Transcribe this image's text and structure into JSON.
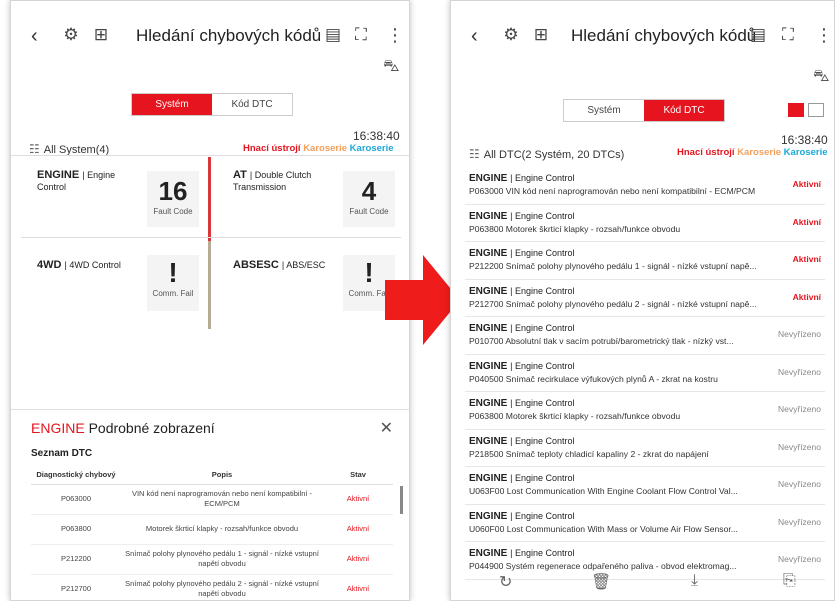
{
  "left": {
    "title": "Hledání chybových kódů",
    "tabs": [
      "Systém",
      "Kód DTC"
    ],
    "active_tab": 0,
    "time": "16:38:40",
    "summary": "All System(4)",
    "categories": [
      "Hnací ústrojí",
      "Karoserie",
      "Karoserie"
    ],
    "cards": [
      {
        "name": "ENGINE",
        "sub": "Engine Control",
        "value": "16",
        "label": "Fault Code",
        "bar_color": "#d9383a"
      },
      {
        "name": "AT",
        "sub": "Double Clutch Transmission",
        "value": "4",
        "label": "Fault Code",
        "bar_color": ""
      },
      {
        "name": "4WD",
        "sub": "4WD Control",
        "value": "!",
        "label": "Comm. Fail",
        "bar_color": "#b8ab95"
      },
      {
        "name": "ABSESC",
        "sub": "ABS/ESC",
        "value": "!",
        "label": "Comm. Fail",
        "bar_color": ""
      }
    ],
    "detail": {
      "system": "ENGINE",
      "title": "Podrobné zobrazení",
      "list_title": "Seznam DTC",
      "columns": [
        "Diagnostický chybový",
        "Popis",
        "Stav"
      ],
      "rows": [
        {
          "code": "P063000",
          "desc": "VIN kód není naprogramován nebo není kompatibilní - ECM/PCM",
          "status": "Aktivní"
        },
        {
          "code": "P063800",
          "desc": "Motorek škrticí klapky - rozsah/funkce obvodu",
          "status": "Aktivní"
        },
        {
          "code": "P212200",
          "desc": "Snímač polohy plynového pedálu 1 - signál - nízké vstupní napětí obvodu",
          "status": "Aktivní"
        },
        {
          "code": "P212700",
          "desc": "Snímač polohy plynového pedálu 2 - signál - nízké vstupní napětí obvodu",
          "status": "Aktivní"
        }
      ]
    }
  },
  "right": {
    "title": "Hledání chybových kódů",
    "tabs": [
      "Systém",
      "Kód DTC"
    ],
    "active_tab": 1,
    "time": "16:38:40",
    "summary": "All DTC(2 Systém, 20 DTCs)",
    "categories": [
      "Hnací ústrojí",
      "Karoserie",
      "Karoserie"
    ],
    "dtcs": [
      {
        "sys": "ENGINE",
        "sub": "Engine Control",
        "desc": "P063000 VIN kód není naprogramován nebo není kompatibilní - ECM/PCM",
        "status": "Aktivní"
      },
      {
        "sys": "ENGINE",
        "sub": "Engine Control",
        "desc": "P063800 Motorek škrticí klapky - rozsah/funkce obvodu",
        "status": "Aktivní"
      },
      {
        "sys": "ENGINE",
        "sub": "Engine Control",
        "desc": "P212200 Snímač polohy plynového pedálu 1 - signál - nízké vstupní napě...",
        "status": "Aktivní"
      },
      {
        "sys": "ENGINE",
        "sub": "Engine Control",
        "desc": "P212700 Snímač polohy plynového pedálu 2 - signál - nízké vstupní napě...",
        "status": "Aktivní"
      },
      {
        "sys": "ENGINE",
        "sub": "Engine Control",
        "desc": "P010700 Absolutní tlak v sacím potrubí/barometrický tlak - nízký vst...",
        "status": "Nevyřízeno"
      },
      {
        "sys": "ENGINE",
        "sub": "Engine Control",
        "desc": "P040500 Snímač recirkulace výfukových plynů A - zkrat na kostru",
        "status": "Nevyřízeno"
      },
      {
        "sys": "ENGINE",
        "sub": "Engine Control",
        "desc": "P063800 Motorek škrticí klapky - rozsah/funkce obvodu",
        "status": "Nevyřízeno"
      },
      {
        "sys": "ENGINE",
        "sub": "Engine Control",
        "desc": "P218500 Snímač teploty chladicí kapaliny 2 - zkrat do napájení",
        "status": "Nevyřízeno"
      },
      {
        "sys": "ENGINE",
        "sub": "Engine Control",
        "desc": "U063F00 Lost Communication With Engine Coolant Flow Control Val...",
        "status": "Nevyřízeno"
      },
      {
        "sys": "ENGINE",
        "sub": "Engine Control",
        "desc": "U060F00 Lost Communication With Mass or Volume Air Flow Sensor...",
        "status": "Nevyřízeno"
      },
      {
        "sys": "ENGINE",
        "sub": "Engine Control",
        "desc": "P044900 Systém regenerace odpařeného paliva - obvod elektromag...",
        "status": "Nevyřízeno"
      }
    ]
  },
  "colors": {
    "accent": "#e5141e",
    "arrow": "#ef1c1c",
    "powertrain": "#e5141e",
    "body1": "#f2a05c",
    "body2": "#1ca8d6"
  }
}
